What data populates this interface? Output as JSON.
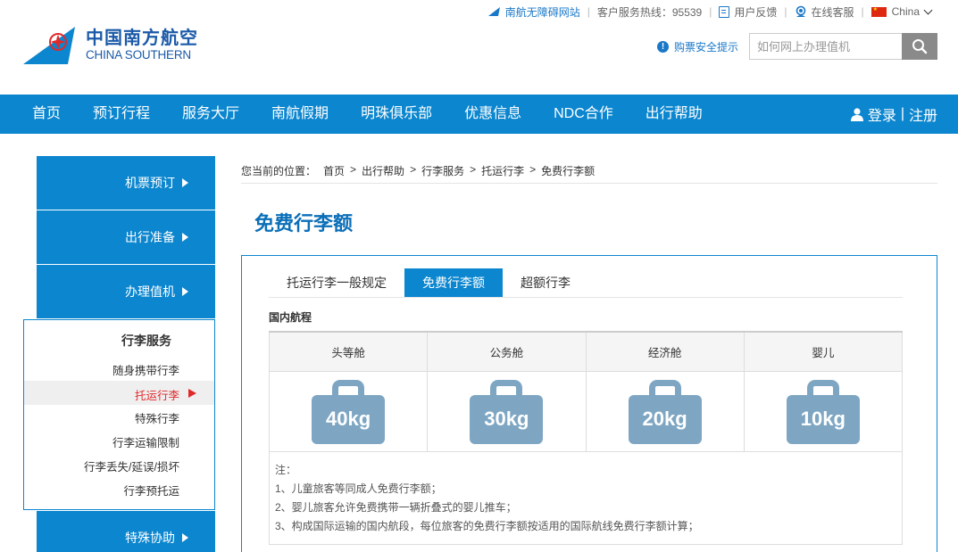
{
  "topbar": {
    "accessible_site": "南航无障碍网站",
    "hotline_label": "客户服务热线：95539",
    "feedback": "用户反馈",
    "online_service": "在线客服",
    "region": "China"
  },
  "logo": {
    "cn": "中国南方航空",
    "en": "CHINA SOUTHERN"
  },
  "safety_tip": "购票安全提示",
  "search": {
    "placeholder": "如何网上办理值机"
  },
  "nav": {
    "items": [
      "首页",
      "预订行程",
      "服务大厅",
      "南航假期",
      "明珠俱乐部",
      "优惠信息",
      "NDC合作",
      "出行帮助"
    ],
    "login": "登录",
    "divider": "|",
    "register": "注册"
  },
  "sidebar": {
    "blocks": [
      "机票预订",
      "出行准备",
      "办理值机",
      "特殊协助"
    ],
    "sub_title": "行李服务",
    "sub_items": [
      "随身携带行李",
      "托运行李",
      "特殊行李",
      "行李运输限制",
      "行李丢失/延误/损坏",
      "行李预托运"
    ],
    "active_index": 1
  },
  "breadcrumb": {
    "prefix": "您当前的位置：",
    "items": [
      "首页",
      "出行帮助",
      "行李服务",
      "托运行李",
      "免费行李额"
    ],
    "separator": ">"
  },
  "page_title": "免费行李额",
  "tabs": [
    "托运行李一般规定",
    "免费行李额",
    "超额行李"
  ],
  "active_tab": 1,
  "section_label": "国内航程",
  "table": {
    "headers": [
      "头等舱",
      "公务舱",
      "经济舱",
      "婴儿"
    ],
    "allowances": [
      "40kg",
      "30kg",
      "20kg",
      "10kg"
    ]
  },
  "notes": {
    "title": "注：",
    "items": [
      "1、儿童旅客等同成人免费行李额；",
      "2、婴儿旅客允许免费携带一辆折叠式的婴儿推车；",
      "3、构成国际运输的国内航段，每位旅客的免费行李额按适用的国际航线免费行李额计算；"
    ]
  },
  "colors": {
    "brand_blue": "#0b86cf",
    "title_blue": "#0b6fb8",
    "active_red": "#e02a2a",
    "bag_gray_blue": "#7ea6c3"
  }
}
